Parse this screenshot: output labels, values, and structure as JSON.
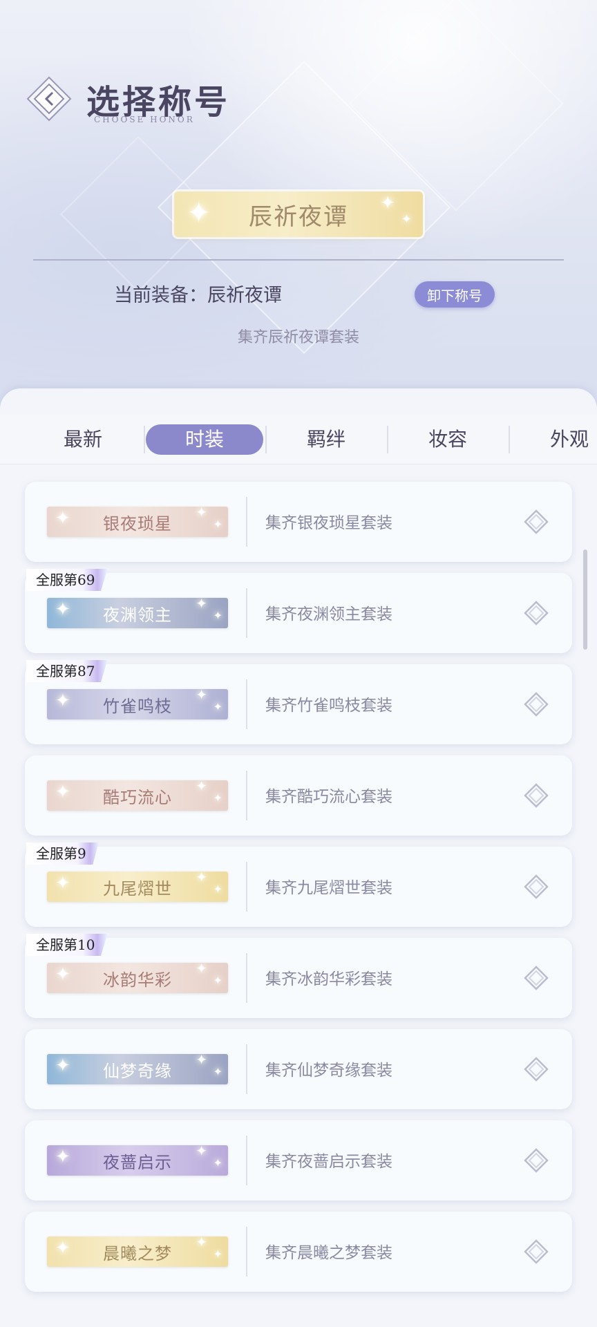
{
  "header": {
    "title": "选择称号",
    "subtitle": "CHOOSE HONOR"
  },
  "current": {
    "badge_text": "辰祈夜谭",
    "equip_label": "当前装备：辰祈夜谭",
    "unequip_label": "卸下称号",
    "description": "集齐辰祈夜谭套装"
  },
  "tabs": [
    {
      "label": "最新",
      "active": false
    },
    {
      "label": "时装",
      "active": true
    },
    {
      "label": "羁绊",
      "active": false
    },
    {
      "label": "妆容",
      "active": false
    },
    {
      "label": "外观",
      "active": false
    }
  ],
  "honors": [
    {
      "name": "银夜琐星",
      "desc": "集齐银夜琐星套装",
      "rank": "",
      "style": "rose"
    },
    {
      "name": "夜渊领主",
      "desc": "集齐夜渊领主套装",
      "rank": "全服第69",
      "style": "blue"
    },
    {
      "name": "竹雀鸣枝",
      "desc": "集齐竹雀鸣枝套装",
      "rank": "全服第87",
      "style": "lavender"
    },
    {
      "name": "酷巧流心",
      "desc": "集齐酷巧流心套装",
      "rank": "",
      "style": "rose"
    },
    {
      "name": "九尾熠世",
      "desc": "集齐九尾熠世套装",
      "rank": "全服第9",
      "style": "gold"
    },
    {
      "name": "冰韵华彩",
      "desc": "集齐冰韵华彩套装",
      "rank": "全服第10",
      "style": "rose"
    },
    {
      "name": "仙梦奇缘",
      "desc": "集齐仙梦奇缘套装",
      "rank": "",
      "style": "blue"
    },
    {
      "name": "夜蔷启示",
      "desc": "集齐夜蔷启示套装",
      "rank": "",
      "style": "purple"
    },
    {
      "name": "晨曦之梦",
      "desc": "集齐晨曦之梦套装",
      "rank": "",
      "style": "gold"
    }
  ],
  "colors": {
    "accent": "#8c88cc",
    "unequip": "#8c8cd6",
    "text_dark": "#4a4560",
    "text_muted": "#8a89a3"
  }
}
